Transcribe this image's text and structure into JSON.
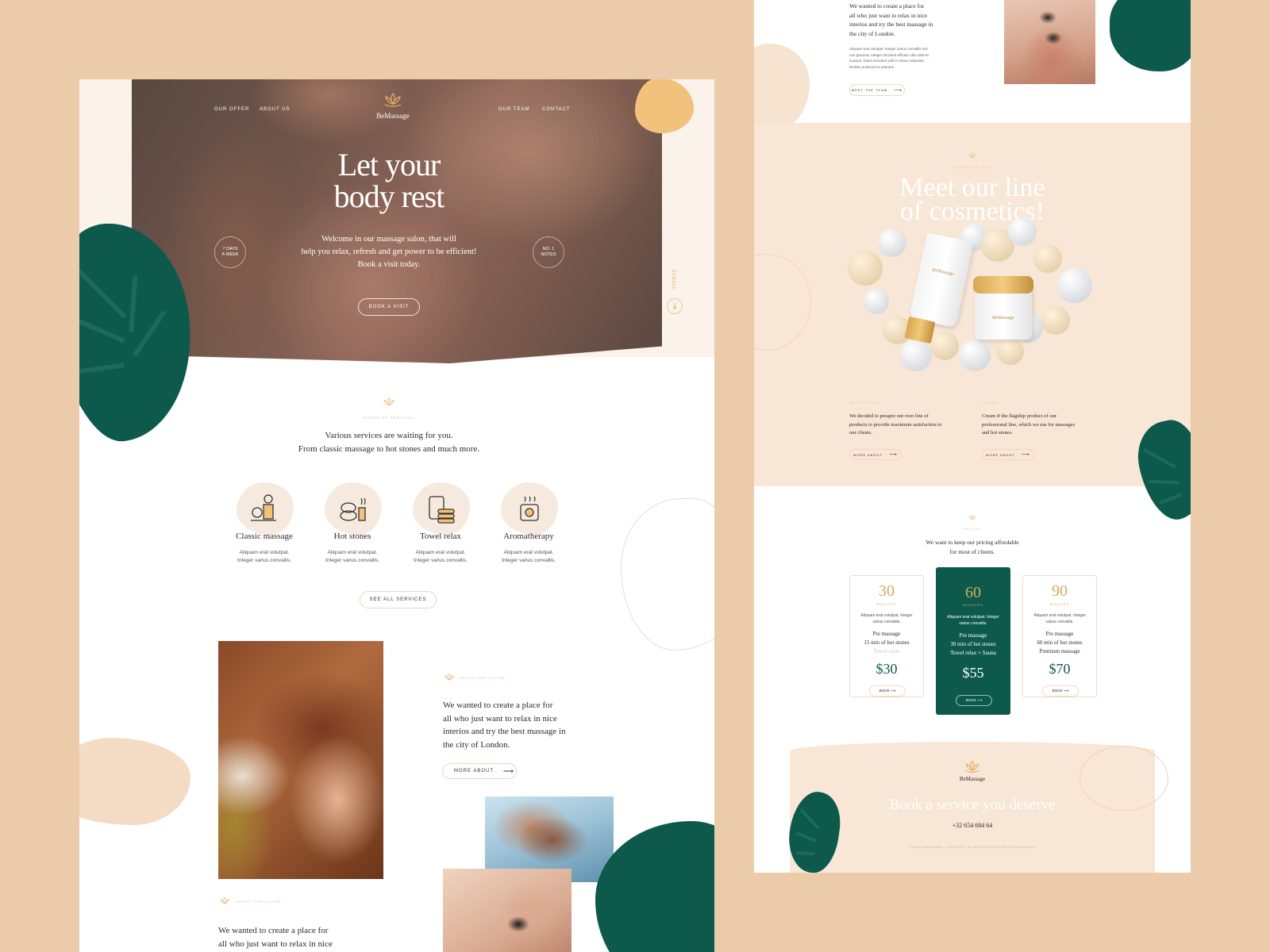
{
  "colors": {
    "background": "#ebcba9",
    "accent_gold": "#d9a85b",
    "dark_green": "#0d5a4c",
    "cream": "#fbf2ea"
  },
  "left": {
    "nav": {
      "offer": "OUR OFFER",
      "about": "ABOUT US",
      "team": "OUR TEAM",
      "contact": "CONTACT"
    },
    "logo_text": "BeMassage",
    "hero": {
      "title_line1": "Let your",
      "title_line2": "body rest",
      "subtitle_line1": "Welcome in our massage salon, that will",
      "subtitle_line2": "help you relax, refresh and get power to be efficient!",
      "subtitle_line3": "Book a visit today.",
      "cta": "BOOK A VISIT",
      "badge_left_line1": "7 DAYS",
      "badge_left_line2": "A WEEK",
      "badge_right_line1": "NO. 1",
      "badge_right_line2": "NOTES",
      "scroll_label": "SCROLL",
      "scroll_icon": "arrow-down-icon"
    },
    "services": {
      "eyebrow": "RANGE OF SERVICES",
      "heading_line1": "Various services are waiting for you.",
      "heading_line2": "From classic massage to hot stones and much more.",
      "items": [
        {
          "title": "Classic massage",
          "desc_line1": "Aliquam erat volutpat.",
          "desc_line2": "Integer varius convallis.",
          "icon": "massage-person-icon"
        },
        {
          "title": "Hot stones",
          "desc_line1": "Aliquam erat volutpat.",
          "desc_line2": "Integer varius convallis.",
          "icon": "hot-stones-icon"
        },
        {
          "title": "Towel relax",
          "desc_line1": "Aliquam erat volutpat.",
          "desc_line2": "Integer varius convallis.",
          "icon": "towel-icon"
        },
        {
          "title": "Aromatherapy",
          "desc_line1": "Aliquam erat volutpat.",
          "desc_line2": "Integer varius convallis.",
          "icon": "aroma-candle-icon"
        }
      ],
      "see_all": "SEE ALL SERVICES"
    },
    "about": {
      "eyebrow": "ABOUT OUR SALON",
      "text_line1": "We wanted to create a place for",
      "text_line2": "all who just want to relax in nice",
      "text_line3": "interios and try the best massage in",
      "text_line4": "the city of London.",
      "button": "MORE ABOUT",
      "eyebrow2": "ABOUT OUR SALON",
      "text2_line1": "We wanted to create a place for",
      "text2_line2": "all who just want to relax in nice"
    }
  },
  "right": {
    "top": {
      "text_line1": "We wanted to create a place for",
      "text_line2": "all who just want to relax in nice",
      "text_line3": "interios and try the best massage in",
      "text_line4": "the city of London.",
      "small_line1": "Aliquam erat volutpat. Integer varius convallis nisl",
      "small_line2": "non placerat. Integer tincidunt efficitur odio ultrices",
      "small_line3": "suscipit. Etiam tincidunt velit in metus vulputate,",
      "small_line4": "facilisis euismod ex posuere.",
      "button": "MEET THE TEAM"
    },
    "cosmetics": {
      "eyebrow": "COSMETICS LINE",
      "title_line1": "Meet our line",
      "title_line2": "of cosmetics!",
      "product_tube": "BeMassage",
      "product_jar": "BeMassage",
      "col1_eyebrow": "BODY LOTION",
      "col1_line1": "We decided to preapre our own line of",
      "col1_line2": "products to provide maximum satisfaction to",
      "col1_line3": "our clients.",
      "col1_button": "MORE ABOUT",
      "col2_eyebrow": "CREAM",
      "col2_line1": "Cream if the flagship product of our",
      "col2_line2": "professional line, which we use for massages",
      "col2_line3": "and hot stones.",
      "col2_button": "MORE ABOUT"
    },
    "pricing": {
      "eyebrow": "PRICING",
      "heading_line1": "We want to keep our pricing affordable",
      "heading_line2": "for most of clients.",
      "cards": [
        {
          "minutes": "30",
          "unit": "MINUTES",
          "desc_line1": "Aliquam erat volutpat. Integer",
          "desc_line2": "varius convallis.",
          "f1": "Pre massage",
          "f2": "15 min of hot stones",
          "f3": "Towel relax",
          "price": "$30",
          "button": "BOOK"
        },
        {
          "minutes": "60",
          "unit": "MINUTES",
          "desc_line1": "Aliquam erat volutpat. Integer",
          "desc_line2": "varius convallis.",
          "f1": "Pre massage",
          "f2": "30 min of hot stones",
          "f3": "Towel relax + Sauna",
          "price": "$55",
          "button": "BOOK"
        },
        {
          "minutes": "90",
          "unit": "MINUTES",
          "desc_line1": "Aliquam erat volutpat. Integer",
          "desc_line2": "varius convallis.",
          "f1": "Pre massage",
          "f2": "60 min of hot stones",
          "f3": "Premium massage",
          "price": "$70",
          "button": "BOOK"
        }
      ]
    },
    "footer": {
      "logo_text": "BeMassage",
      "cta_title": "Book a service you deserve",
      "phone": "+32 654 684 64",
      "copyright": "© 2020 BEMASSAGE — NETWORK. ALL RIGHTS RESERVED. DESIGN GROUP"
    }
  }
}
